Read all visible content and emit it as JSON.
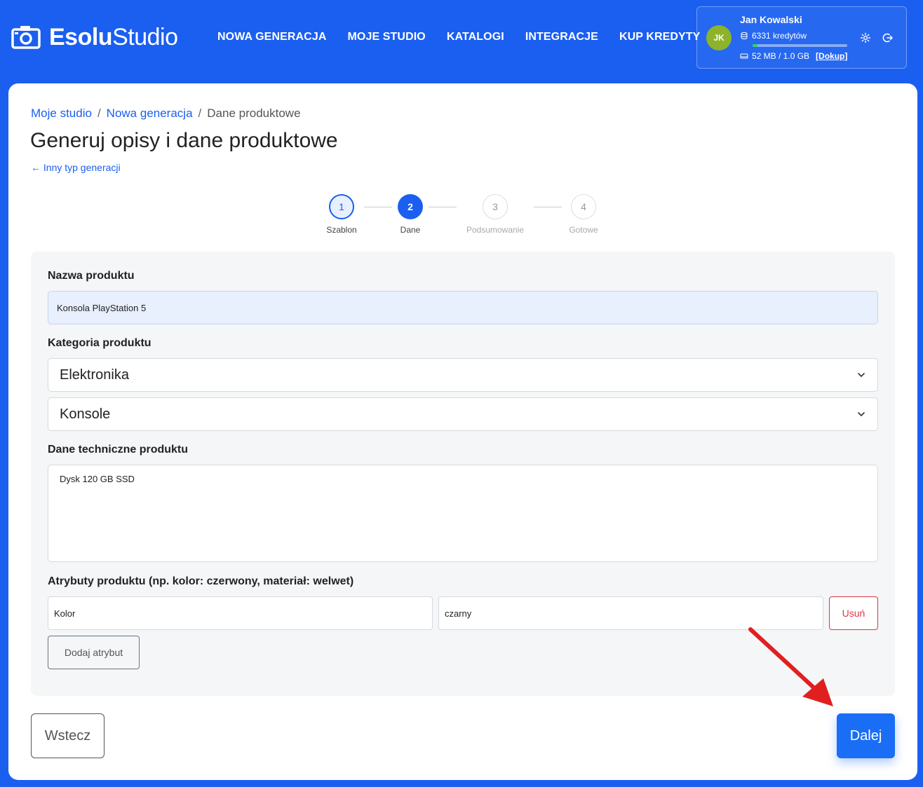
{
  "brand": {
    "bold": "Esolu",
    "regular": "Studio"
  },
  "nav": [
    {
      "label": "NOWA GENERACJA"
    },
    {
      "label": "MOJE STUDIO"
    },
    {
      "label": "KATALOGI"
    },
    {
      "label": "INTEGRACJE"
    },
    {
      "label": "KUP KREDYTY"
    }
  ],
  "user": {
    "initials": "JK",
    "name": "Jan Kowalski",
    "credits": "6331 kredytów",
    "storage": "52 MB / 1.0 GB",
    "storage_used_fraction": 0.05,
    "topup": "[Dokup]",
    "avatar_color": "#8db32b"
  },
  "breadcrumb": {
    "items": [
      "Moje studio",
      "Nowa generacja"
    ],
    "current": "Dane produktowe",
    "separator": "/"
  },
  "page": {
    "title": "Generuj opisy i dane produktowe",
    "back_link": "← Inny typ generacji"
  },
  "steps": [
    {
      "num": "1",
      "label": "Szablon",
      "state": "done"
    },
    {
      "num": "2",
      "label": "Dane",
      "state": "active"
    },
    {
      "num": "3",
      "label": "Podsumowanie",
      "state": "todo"
    },
    {
      "num": "4",
      "label": "Gotowe",
      "state": "todo"
    }
  ],
  "form": {
    "name_label": "Nazwa produktu",
    "name_value": "Konsola PlayStation 5",
    "category_label": "Kategoria produktu",
    "category_value": "Elektronika",
    "subcategory_value": "Konsole",
    "tech_label": "Dane techniczne produktu",
    "tech_value": "Dysk 120 GB SSD",
    "attrs_label": "Atrybuty produktu (np. kolor: czerwony, materiał: welwet)",
    "attr_key": "Kolor",
    "attr_value": "czarny",
    "remove_label": "Usuń",
    "add_label": "Dodaj atrybut"
  },
  "actions": {
    "back": "Wstecz",
    "next": "Dalej"
  },
  "colors": {
    "primary": "#1a5ff0",
    "danger": "#dc3545",
    "annotation_arrow": "#e02020"
  }
}
